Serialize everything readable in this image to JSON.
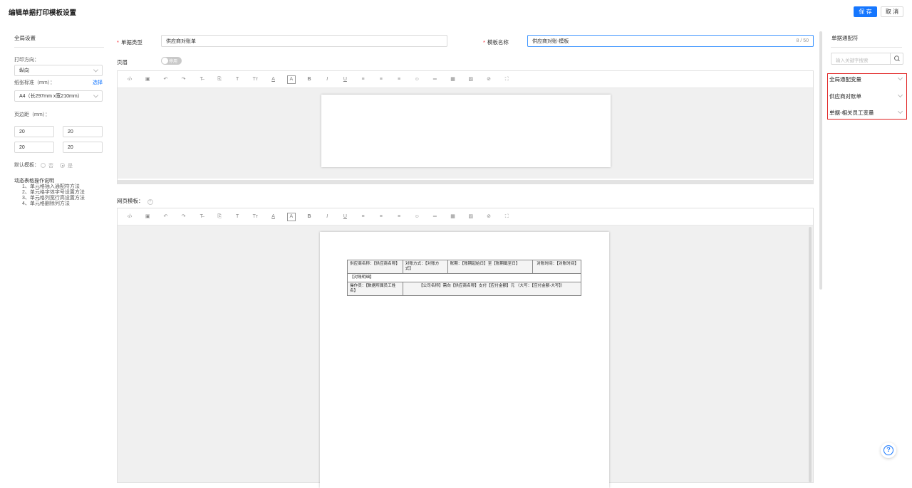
{
  "header": {
    "title": "编辑单据打印模板设置",
    "save_label": "保 存",
    "cancel_label": "取 消"
  },
  "left_panel": {
    "title": "全局设置",
    "print_direction_label": "打印方向：",
    "print_direction_value": "纵向",
    "paper_label": "纸张标准（mm）：",
    "paper_link": "选择",
    "paper_value": "A4（长297mm x宽210mm）",
    "margin_label": "页边距（mm）：",
    "margins": [
      "20",
      "20",
      "20",
      "20"
    ],
    "default_label": "默认模板：",
    "default_options": [
      "否",
      "是"
    ],
    "default_selected": "是",
    "help_title": "动态表格操作说明",
    "help_items": [
      "1、单元格插入通配符方法",
      "2、单元格字体字号设置方法",
      "3、单元格列宽行高设置方法",
      "4、单元格删除列方法"
    ]
  },
  "form": {
    "doc_type_label": "单据类型",
    "doc_type_value": "供应商对账单",
    "template_name_label": "模板名称",
    "template_name_value": "供应商对账-模板",
    "template_name_counter": "8 / 50",
    "header_label": "页眉",
    "header_toggle_text": "停用",
    "web_template_label": "网页模板："
  },
  "toolbar_icons": [
    "code-icon",
    "template-icon",
    "undo-icon",
    "redo-icon",
    "strikethrough-icon",
    "format-painter-icon",
    "heading-icon",
    "font-size-icon",
    "font-color-icon",
    "background-color-icon",
    "bold-icon",
    "italic-icon",
    "underline-icon",
    "align-left-icon",
    "align-center-icon",
    "align-right-icon",
    "emoji-icon",
    "horizontal-rule-icon",
    "table-icon",
    "image-icon",
    "attachment-icon",
    "fullscreen-icon"
  ],
  "toolbar_glyphs": [
    "‹/›",
    "▣",
    "↶",
    "↷",
    "T̶",
    "⎘",
    "T",
    "Tт",
    "A",
    "A",
    "B",
    "I",
    "U",
    "≡",
    "≡",
    "≡",
    "☺",
    "═",
    "▦",
    "▨",
    "⊘",
    "⛶"
  ],
  "table": {
    "row1": [
      "供应商名称：【供应商名称】",
      "对账方式：【对账方式】",
      "账期：【账期起始日】至【账期截至日】",
      "对账时间：【对账时间】"
    ],
    "row2": "【对账明细】",
    "row3": [
      "操作员：【数据所属员工姓名】",
      "【公司名称】需向【供应商名称】支付【应付金额】元 （大写：【应付金额-大写】）"
    ]
  },
  "right_panel": {
    "title": "单据通配符",
    "search_placeholder": "输入关键字搜索",
    "groups": [
      "全局通配变量",
      "供应商对账单",
      "单据-相关员工变量"
    ]
  },
  "colors": {
    "primary": "#1677ff",
    "highlight_border": "#e02020"
  }
}
